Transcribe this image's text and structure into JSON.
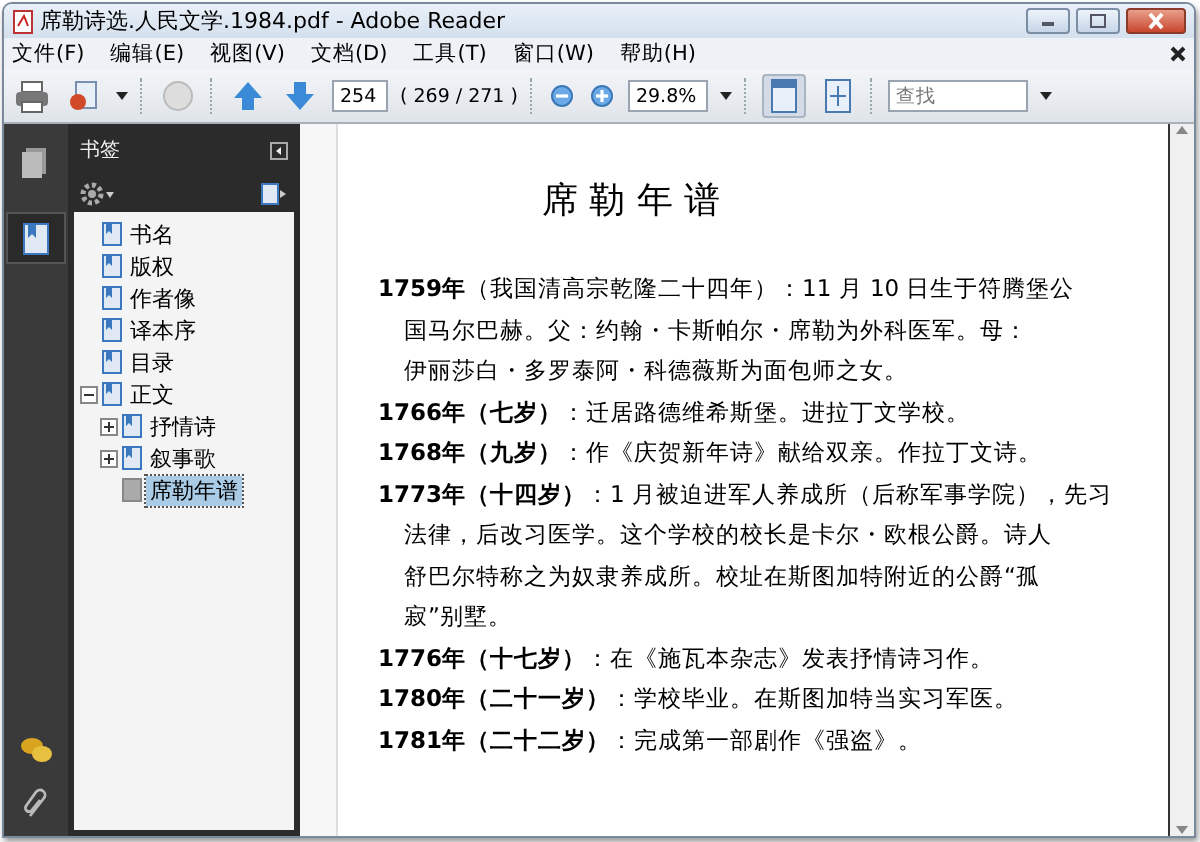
{
  "window": {
    "title": "席勒诗选.人民文学.1984.pdf - Adobe Reader"
  },
  "menu": [
    "文件(F)",
    "编辑(E)",
    "视图(V)",
    "文档(D)",
    "工具(T)",
    "窗口(W)",
    "帮助(H)"
  ],
  "toolbar": {
    "page_number": "254",
    "page_count": "( 269 / 271 )",
    "zoom": "29.8%",
    "search": {
      "placeholder": "查找"
    },
    "view_buttons": [
      {
        "kind": "fit-page",
        "selected": true
      },
      {
        "kind": "fit-width",
        "selected": false
      }
    ]
  },
  "side_tabs": [
    {
      "kind": "pages",
      "selected": false
    },
    {
      "kind": "bookmarks",
      "selected": true
    }
  ],
  "bookmarks": {
    "title": "书签",
    "items": [
      {
        "label": "书名",
        "kind": "bookmark",
        "selected": false
      },
      {
        "label": "版权",
        "kind": "bookmark",
        "selected": false
      },
      {
        "label": "作者像",
        "kind": "bookmark",
        "selected": false
      },
      {
        "label": "译本序",
        "kind": "bookmark",
        "selected": false
      },
      {
        "label": "目录",
        "kind": "bookmark",
        "selected": false
      },
      {
        "label": "正文",
        "kind": "bookmark",
        "selected": false,
        "expanded": true,
        "children": [
          {
            "label": "抒情诗",
            "kind": "bookmark",
            "selected": false,
            "expanded": false
          },
          {
            "label": "叙事歌",
            "kind": "bookmark",
            "selected": false,
            "expanded": false
          },
          {
            "label": "席勒年谱",
            "kind": "plain",
            "selected": true
          }
        ]
      }
    ]
  },
  "document": {
    "heading": "席 勒 年 谱",
    "entries": [
      {
        "lines": [
          "**1759年**（我国清高宗乾隆二十四年）：11 月 10 日生于符腾堡公",
          "国马尔巴赫。父：约翰・卡斯帕尔・席勒为外科医军。母：",
          "伊丽莎白・多罗泰阿・科德薇斯为面包师之女。"
        ]
      },
      {
        "lines": [
          "**1766年（七岁）**：迁居路德维希斯堡。进拉丁文学校。"
        ]
      },
      {
        "lines": [
          "**1768年（九岁）**：作《庆贺新年诗》献给双亲。作拉丁文诗。"
        ]
      },
      {
        "lines": [
          "**1773年（十四岁）**：1 月被迫进军人养成所（后称军事学院），先习",
          "法律，后改习医学。这个学校的校长是卡尔・欧根公爵。诗人",
          "舒巴尔特称之为奴隶养成所。校址在斯图加特附近的公爵“孤",
          "寂”别墅。"
        ]
      },
      {
        "lines": [
          "**1776年（十七岁）**：在《施瓦本杂志》发表抒情诗习作。"
        ]
      },
      {
        "lines": [
          "**1780年（二十一岁）**：学校毕业。在斯图加特当实习军医。"
        ]
      },
      {
        "lines": [
          "**1781年（二十二岁）**：完成第一部剧作《强盗》。"
        ]
      }
    ]
  }
}
